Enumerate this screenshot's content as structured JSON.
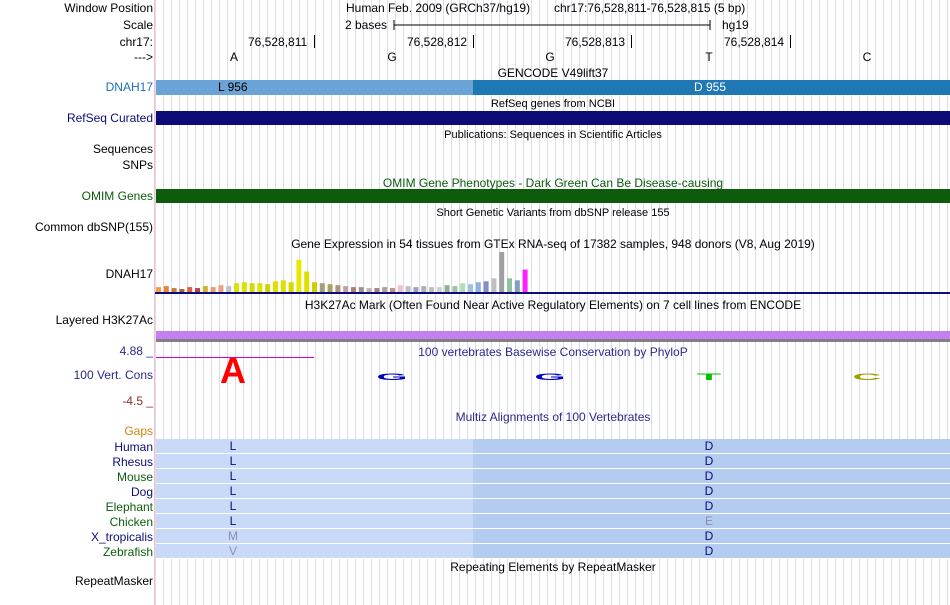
{
  "labels": {
    "window_position": "Window Position",
    "scale": "Scale",
    "chr": "chr17:",
    "arrow": "--->",
    "dnah17_gene": "DNAH17",
    "refseq": "RefSeq Curated",
    "sequences": "Sequences",
    "snps": "SNPs",
    "omim": "OMIM Genes",
    "dbsnp": "Common dbSNP(155)",
    "gtex": "DNAH17",
    "h3k27ac": "Layered H3K27Ac",
    "cons": "100 Vert. Cons",
    "gaps": "Gaps",
    "repeatmasker": "RepeatMasker",
    "cons_max": "4.88 _",
    "cons_min": "-4.5 _"
  },
  "header": {
    "assembly": "Human Feb. 2009 (GRCh37/hg19)",
    "position": "chr17:76,528,811-76,528,815 (5 bp)",
    "scale_text": "2 bases",
    "scale_db": "hg19",
    "ticks": [
      "76,528,811",
      "76,528,812",
      "76,528,813",
      "76,528,814"
    ],
    "bases": [
      "A",
      "G",
      "G",
      "T",
      "C"
    ]
  },
  "tracks": {
    "gencode_title": "GENCODE V49lift37",
    "gencode_aa1": "L 956",
    "gencode_aa2": "D 955",
    "refseq_title": "RefSeq genes from NCBI",
    "pubs_title": "Publications: Sequences in Scientific Articles",
    "omim_title": "OMIM Gene Phenotypes - Dark Green Can Be Disease-causing",
    "dbsnp_title": "Short Genetic Variants from dbSNP release 155",
    "gtex_title": "Gene Expression in 54 tissues from GTEx RNA-seq of 17382 samples, 948 donors (V8, Aug 2019)",
    "h3k27ac_title": "H3K27Ac Mark (Often Found Near Active Regulatory Elements) on 7 cell lines from ENCODE",
    "phylop_title": "100 vertebrates Basewise Conservation by PhyloP",
    "multiz_title": "Multiz Alignments of 100 Vertebrates",
    "rmsk_title": "Repeating Elements by RepeatMasker"
  },
  "colors": {
    "gencode_light": "#6aa3d5",
    "gencode_dark": "#1f78b4",
    "refseq": "#0c0c78",
    "omim": "#0c5c0c",
    "h3k27ac": "#c47ff0",
    "label_blue": "#1f6fb4",
    "label_navy": "#0c0c78",
    "label_green": "#0c5c0c",
    "cons_label": "#2a2a8c",
    "gaps_label": "#d4820c",
    "species_navy": "#0c0c78",
    "species_green": "#0c5c0c",
    "aln_light": "#c8daf7",
    "aln_dark": "#b4ccef"
  },
  "logo": [
    {
      "base": "A",
      "color": "#ff0000",
      "size": "large"
    },
    {
      "base": "G",
      "color": "#0000c0",
      "size": "small"
    },
    {
      "base": "G",
      "color": "#0000c0",
      "size": "small"
    },
    {
      "base": "T",
      "color": "#00c000",
      "size": "small"
    },
    {
      "base": "C",
      "color": "#a0a000",
      "size": "small"
    }
  ],
  "gtex_bars": [
    {
      "v": 5,
      "c": "#f0a040"
    },
    {
      "v": 6,
      "c": "#f08030"
    },
    {
      "v": 4,
      "c": "#c08040"
    },
    {
      "v": 3,
      "c": "#a06030"
    },
    {
      "v": 5,
      "c": "#e06040"
    },
    {
      "v": 4,
      "c": "#c04040"
    },
    {
      "v": 6,
      "c": "#d0b030"
    },
    {
      "v": 5,
      "c": "#e0a070"
    },
    {
      "v": 7,
      "c": "#f0a080"
    },
    {
      "v": 6,
      "c": "#c0c0c0"
    },
    {
      "v": 9,
      "c": "#e0e000"
    },
    {
      "v": 10,
      "c": "#e0e000"
    },
    {
      "v": 9,
      "c": "#d8d800"
    },
    {
      "v": 9,
      "c": "#e0e000"
    },
    {
      "v": 8,
      "c": "#d0d000"
    },
    {
      "v": 11,
      "c": "#e0e000"
    },
    {
      "v": 12,
      "c": "#e0e000"
    },
    {
      "v": 10,
      "c": "#d8d800"
    },
    {
      "v": 33,
      "c": "#e8e800"
    },
    {
      "v": 21,
      "c": "#e0e000"
    },
    {
      "v": 10,
      "c": "#d0d000"
    },
    {
      "v": 9,
      "c": "#a0a080"
    },
    {
      "v": 8,
      "c": "#b0a060"
    },
    {
      "v": 7,
      "c": "#b09080"
    },
    {
      "v": 6,
      "c": "#c0a0a0"
    },
    {
      "v": 5,
      "c": "#b08070"
    },
    {
      "v": 5,
      "c": "#a09090"
    },
    {
      "v": 4,
      "c": "#c0b0b0"
    },
    {
      "v": 4,
      "c": "#a08080"
    },
    {
      "v": 5,
      "c": "#b0a0a0"
    },
    {
      "v": 4,
      "c": "#c09080"
    },
    {
      "v": 7,
      "c": "#f0c0d0"
    },
    {
      "v": 6,
      "c": "#c0c0c0"
    },
    {
      "v": 5,
      "c": "#a0a0c0"
    },
    {
      "v": 6,
      "c": "#b0b0b0"
    },
    {
      "v": 5,
      "c": "#c0c0b0"
    },
    {
      "v": 5,
      "c": "#d0d0d0"
    },
    {
      "v": 7,
      "c": "#90b090"
    },
    {
      "v": 6,
      "c": "#a0c0a0"
    },
    {
      "v": 9,
      "c": "#b0e0b0"
    },
    {
      "v": 8,
      "c": "#a0c0e0"
    },
    {
      "v": 10,
      "c": "#90b0e0"
    },
    {
      "v": 11,
      "c": "#8090c0"
    },
    {
      "v": 14,
      "c": "#c0c0c0"
    },
    {
      "v": 41,
      "c": "#a0a0a0"
    },
    {
      "v": 14,
      "c": "#90c0a0"
    },
    {
      "v": 12,
      "c": "#80a0c0"
    },
    {
      "v": 23,
      "c": "#ff20ff"
    }
  ],
  "species": [
    {
      "name": "Human",
      "color": "#0c0c78",
      "aa1": "L",
      "aa2": "D",
      "aa1_faded": false,
      "aa2_faded": false
    },
    {
      "name": "Rhesus",
      "color": "#0c0c78",
      "aa1": "L",
      "aa2": "D",
      "aa1_faded": false,
      "aa2_faded": false
    },
    {
      "name": "Mouse",
      "color": "#0c5c0c",
      "aa1": "L",
      "aa2": "D",
      "aa1_faded": false,
      "aa2_faded": false
    },
    {
      "name": "Dog",
      "color": "#0c0c78",
      "aa1": "L",
      "aa2": "D",
      "aa1_faded": false,
      "aa2_faded": false
    },
    {
      "name": "Elephant",
      "color": "#0c5c0c",
      "aa1": "L",
      "aa2": "D",
      "aa1_faded": false,
      "aa2_faded": false
    },
    {
      "name": "Chicken",
      "color": "#0c5c0c",
      "aa1": "L",
      "aa2": "E",
      "aa1_faded": false,
      "aa2_faded": true
    },
    {
      "name": "X_tropicalis",
      "color": "#0c0c78",
      "aa1": "M",
      "aa2": "D",
      "aa1_faded": true,
      "aa2_faded": false
    },
    {
      "name": "Zebrafish",
      "color": "#0c5c0c",
      "aa1": "V",
      "aa2": "D",
      "aa1_faded": true,
      "aa2_faded": false
    }
  ]
}
